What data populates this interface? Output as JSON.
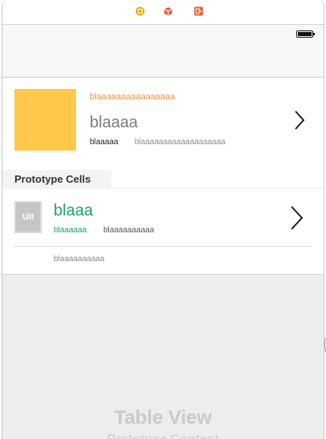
{
  "scene_dock": {
    "icons": [
      "view-controller-icon",
      "first-responder-icon",
      "exit-icon"
    ],
    "colors": {
      "vc": "#f0a800",
      "cube": "#e0643c",
      "exit": "#e0643c"
    }
  },
  "status_bar": {
    "battery_icon": "battery-icon"
  },
  "table": {
    "cell1": {
      "top_text": "blaaaaaaaaaaaaaaaa",
      "title": "blaaaa",
      "subtitle": "blaaaaa",
      "detail": "blaaaaaaaaaaaaaaaaaaa",
      "thumb_color": "#ffc84a"
    },
    "section": {
      "title": "Prototype Cells"
    },
    "cell2": {
      "icon_text": "UII",
      "title": "blaaa",
      "subtitle": "blaaaaaa",
      "detail": "blaaaaaaaaaa",
      "accent": "#1aa16a"
    },
    "cell3": {
      "text": "blaaaaaaaaaa"
    }
  },
  "placeholder": {
    "title": "Table View",
    "subtitle": "Prototype Content"
  }
}
